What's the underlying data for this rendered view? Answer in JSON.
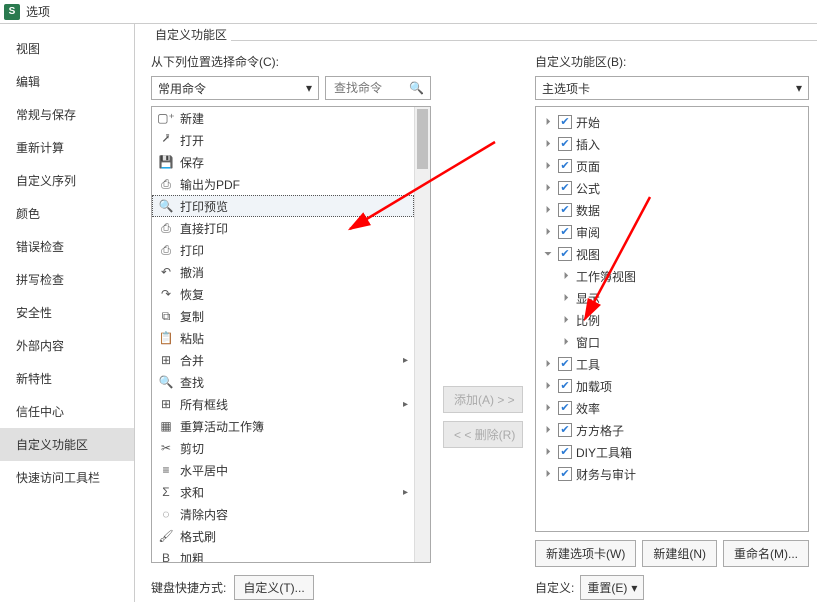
{
  "title": "选项",
  "sidebar": {
    "items": [
      {
        "label": "视图"
      },
      {
        "label": "编辑"
      },
      {
        "label": "常规与保存"
      },
      {
        "label": "重新计算"
      },
      {
        "label": "自定义序列"
      },
      {
        "label": "颜色"
      },
      {
        "label": "错误检查"
      },
      {
        "label": "拼写检查"
      },
      {
        "label": "安全性"
      },
      {
        "label": "外部内容"
      },
      {
        "label": "新特性"
      },
      {
        "label": "信任中心"
      },
      {
        "label": "自定义功能区"
      },
      {
        "label": "快速访问工具栏"
      }
    ],
    "selected_index": 12
  },
  "group_title": "自定义功能区",
  "left": {
    "label": "从下列位置选择命令(C):",
    "dropdown": "常用命令",
    "search_placeholder": "查找命令",
    "commands": [
      {
        "icon": "new-icon",
        "glyph": "▢⁺",
        "label": "新建"
      },
      {
        "icon": "open-icon",
        "glyph": "⭷",
        "label": "打开"
      },
      {
        "icon": "save-icon",
        "glyph": "💾",
        "label": "保存"
      },
      {
        "icon": "pdf-icon",
        "glyph": "⎙",
        "label": "输出为PDF"
      },
      {
        "icon": "preview-icon",
        "glyph": "🔍",
        "label": "打印预览",
        "selected": true
      },
      {
        "icon": "direct-print-icon",
        "glyph": "⎙",
        "label": "直接打印"
      },
      {
        "icon": "print-icon",
        "glyph": "⎙",
        "label": "打印"
      },
      {
        "icon": "undo-icon",
        "glyph": "↶",
        "label": "撤消"
      },
      {
        "icon": "redo-icon",
        "glyph": "↷",
        "label": "恢复"
      },
      {
        "icon": "copy-icon",
        "glyph": "⧉",
        "label": "复制"
      },
      {
        "icon": "paste-icon",
        "glyph": "📋",
        "label": "粘贴"
      },
      {
        "icon": "merge-icon",
        "glyph": "⊞",
        "label": "合并",
        "has_sub": true
      },
      {
        "icon": "find-icon",
        "glyph": "🔍",
        "label": "查找"
      },
      {
        "icon": "borders-icon",
        "glyph": "⊞",
        "label": "所有框线",
        "has_sub": true
      },
      {
        "icon": "recalc-icon",
        "glyph": "▦",
        "label": "重算活动工作簿"
      },
      {
        "icon": "cut-icon",
        "glyph": "✂",
        "label": "剪切"
      },
      {
        "icon": "center-icon",
        "glyph": "≡",
        "label": "水平居中"
      },
      {
        "icon": "sum-icon",
        "glyph": "Σ",
        "label": "求和",
        "has_sub": true
      },
      {
        "icon": "clear-icon",
        "glyph": "◌",
        "label": "清除内容"
      },
      {
        "icon": "format-painter-icon",
        "glyph": "🖌",
        "label": "格式刷"
      },
      {
        "icon": "bold-icon",
        "glyph": "B",
        "label": "加粗"
      }
    ],
    "keyboard_label": "键盘快捷方式:",
    "keyboard_btn": "自定义(T)..."
  },
  "mid": {
    "add_btn": "添加(A) > >",
    "remove_btn": "< < 删除(R)"
  },
  "right": {
    "label": "自定义功能区(B):",
    "dropdown": "主选项卡",
    "tree": [
      {
        "label": "开始",
        "checked": true,
        "expanded": false
      },
      {
        "label": "插入",
        "checked": true,
        "expanded": false
      },
      {
        "label": "页面",
        "checked": true,
        "expanded": false
      },
      {
        "label": "公式",
        "checked": true,
        "expanded": false
      },
      {
        "label": "数据",
        "checked": true,
        "expanded": false
      },
      {
        "label": "审阅",
        "checked": true,
        "expanded": false
      },
      {
        "label": "视图",
        "checked": true,
        "expanded": true,
        "children": [
          {
            "label": "工作簿视图"
          },
          {
            "label": "显示"
          },
          {
            "label": "比例"
          },
          {
            "label": "窗口"
          }
        ]
      },
      {
        "label": "工具",
        "checked": true,
        "expanded": false
      },
      {
        "label": "加载项",
        "checked": true,
        "expanded": false
      },
      {
        "label": "效率",
        "checked": true,
        "expanded": false
      },
      {
        "label": "方方格子",
        "checked": true,
        "expanded": false
      },
      {
        "label": "DIY工具箱",
        "checked": true,
        "expanded": false
      },
      {
        "label": "财务与审计",
        "checked": true,
        "expanded": false
      }
    ],
    "btn_new_tab": "新建选项卡(W)",
    "btn_new_group": "新建组(N)",
    "btn_rename": "重命名(M)...",
    "customize_label": "自定义:",
    "reset_btn": "重置(E)"
  }
}
